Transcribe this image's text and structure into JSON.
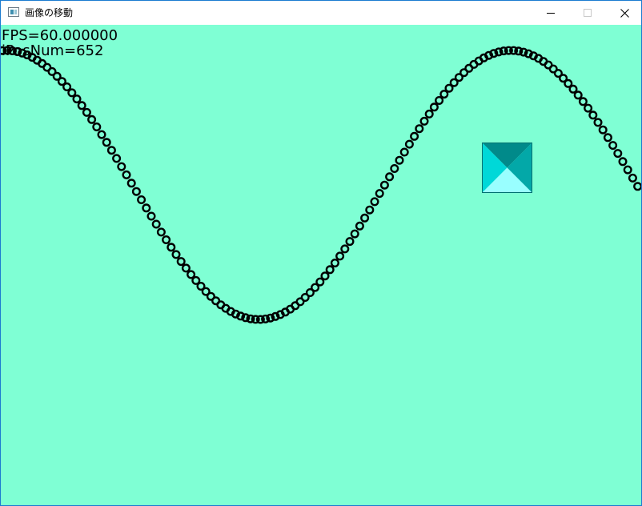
{
  "window": {
    "title": "画像の移動",
    "controls": {
      "minimize": "minimize-icon",
      "maximize": "maximize-icon",
      "close": "close-icon"
    }
  },
  "game": {
    "background_color": "#7fffd4",
    "hud": {
      "fps_text": "FPS=60.000000",
      "pos_text": "iPosNum=652"
    },
    "trail": {
      "shape": "circle-outline",
      "color": "#000000"
    },
    "sprite": {
      "shape": "pyramid-tile",
      "colors": {
        "top": "#018a8a",
        "right": "#03a8a8",
        "left": "#00d8d8",
        "bottom": "#99ffff"
      }
    }
  }
}
